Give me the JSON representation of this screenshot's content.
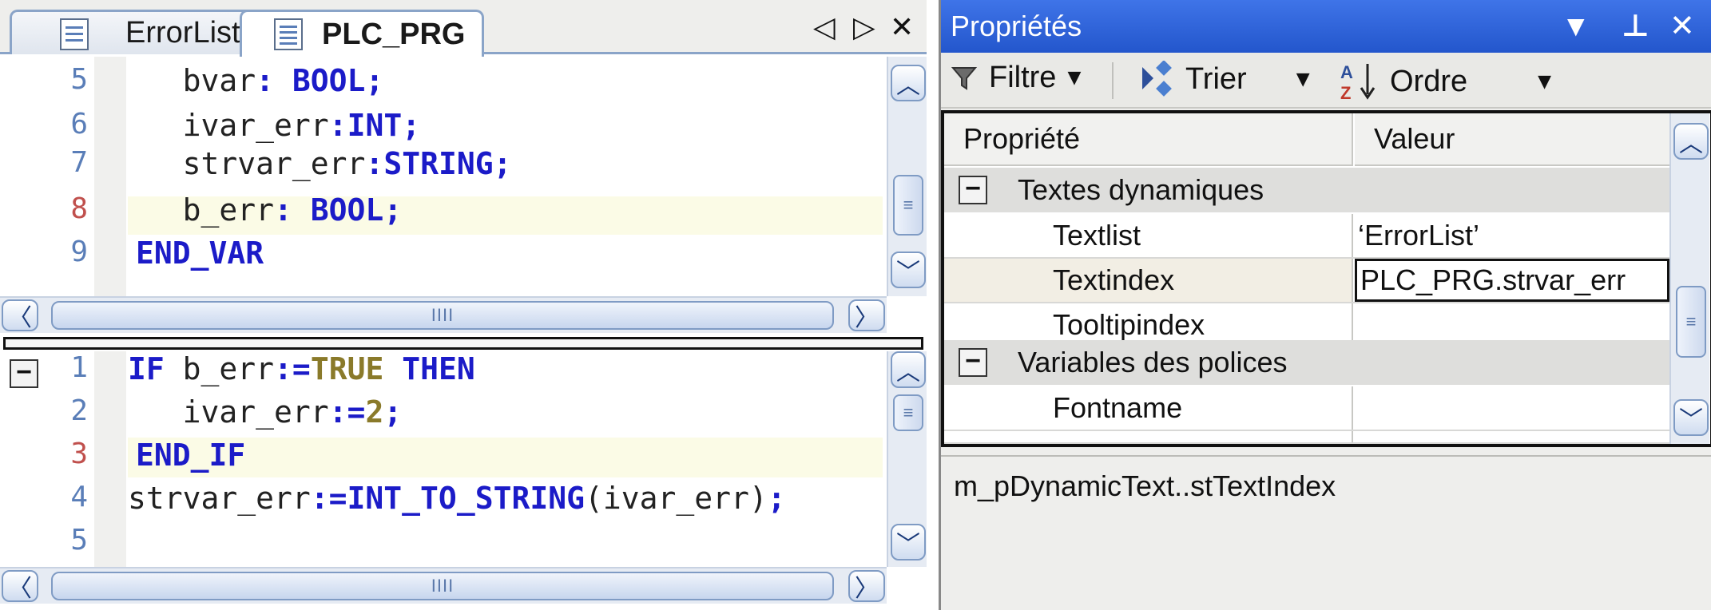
{
  "editor": {
    "tabs": [
      {
        "label": "ErrorList",
        "active": false
      },
      {
        "label": "PLC_PRG",
        "active": true
      }
    ],
    "nav_icons": [
      "triangle-left-icon",
      "triangle-right-icon",
      "close-icon"
    ],
    "nav_glyphs": {
      "prev": "◁",
      "next": "▷",
      "close": "✕"
    },
    "declarations": {
      "lines": [
        {
          "num": "5",
          "indent": "   ",
          "ident": "bvar",
          "sep": ": ",
          "type": "BOOL",
          "end": ";"
        },
        {
          "num": "6",
          "indent": "   ",
          "ident": "ivar_err",
          "sep": ":",
          "type": "INT",
          "end": ";"
        },
        {
          "num": "7",
          "indent": "   ",
          "ident": "strvar_err",
          "sep": ":",
          "type": "STRING",
          "end": ";"
        },
        {
          "num": "8",
          "indent": "   ",
          "ident": "b_err",
          "sep": ": ",
          "type": "BOOL",
          "end": ";"
        },
        {
          "num": "9",
          "keyword": "END_VAR"
        }
      ]
    },
    "implementation": {
      "lines": [
        {
          "num": "1",
          "text_a": "IF",
          "text_b": " b_err",
          "text_c": ":=",
          "text_d": "TRUE",
          "text_e": " THEN"
        },
        {
          "num": "2",
          "text_a": "   ivar_err",
          "text_b": ":=",
          "text_c": "2",
          "text_d": ";"
        },
        {
          "num": "3",
          "text_a": "END_IF"
        },
        {
          "num": "4",
          "text_a": "strvar_err",
          "text_b": ":=",
          "text_c": "INT_TO_STRING",
          "text_d": "(ivar_err)",
          "text_e": ";"
        },
        {
          "num": "5"
        }
      ]
    },
    "collapse_glyph": "−",
    "scroll_glyphs": {
      "up": "︿",
      "down": "﹀",
      "left": "〈",
      "right": "〉",
      "grip_v": "≡",
      "grip_h": "IIII"
    }
  },
  "properties": {
    "title": "Propriétés",
    "title_glyphs": {
      "dropdown": "▼",
      "pin": "⊥",
      "close": "✕"
    },
    "toolbar": {
      "filter_label": "Filtre",
      "sort_label": "Trier",
      "order_label": "Ordre",
      "caret": "▼"
    },
    "columns": {
      "property": "Propriété",
      "value": "Valeur"
    },
    "groups": [
      {
        "name": "Textes dynamiques",
        "rows": [
          {
            "name": "Textlist",
            "value": "‘ErrorList’"
          },
          {
            "name": "Textindex",
            "value": "PLC_PRG.strvar_err"
          },
          {
            "name": "Tooltipindex",
            "value": ""
          }
        ]
      },
      {
        "name": "Variables des polices",
        "rows": [
          {
            "name": "Fontname",
            "value": ""
          }
        ]
      }
    ],
    "description": "m_pDynamicText..stTextIndex"
  }
}
